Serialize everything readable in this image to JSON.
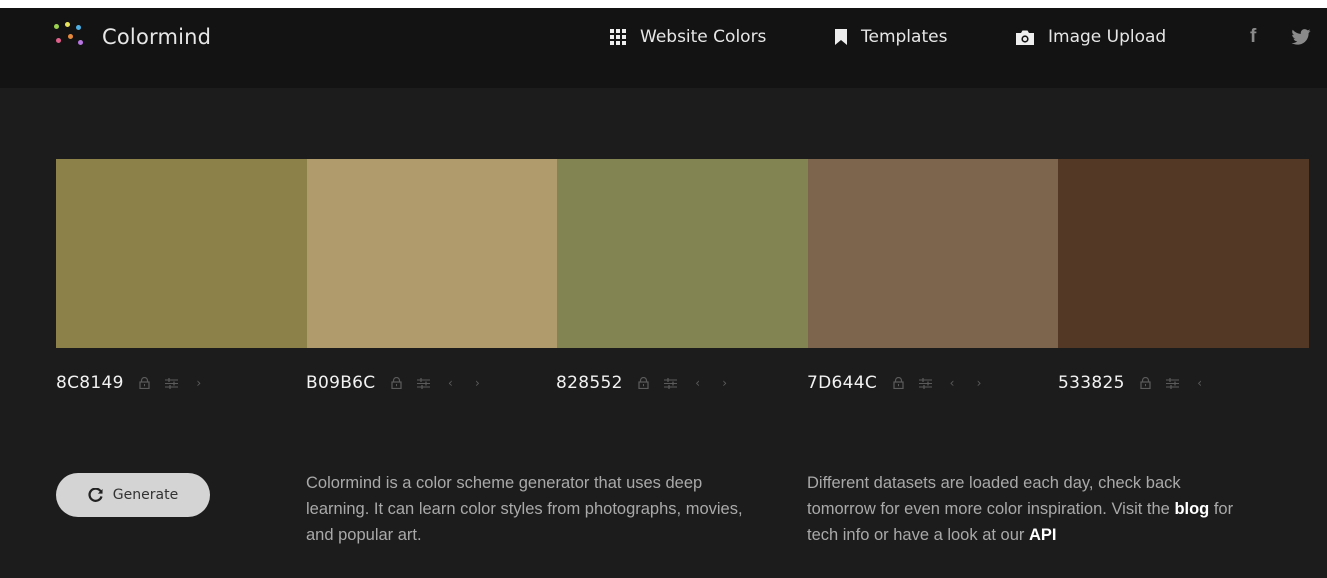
{
  "brand": {
    "name": "Colormind",
    "dot_colors": [
      "#9bd14f",
      "#e8e35a",
      "#4fb0e3",
      "#e0608c",
      "#e58a3c",
      "#b776e0"
    ]
  },
  "nav": {
    "website_colors": "Website Colors",
    "templates": "Templates",
    "image_upload": "Image Upload"
  },
  "social": {
    "facebook": "f"
  },
  "palette": [
    {
      "hex": "8C8149",
      "color": "#8C8149"
    },
    {
      "hex": "B09B6C",
      "color": "#B09B6C"
    },
    {
      "hex": "828552",
      "color": "#828552"
    },
    {
      "hex": "7D644C",
      "color": "#7D644C"
    },
    {
      "hex": "533825",
      "color": "#533825"
    }
  ],
  "controls": {
    "lock": "lock-icon",
    "adjust": "sliders-icon",
    "prev": "‹",
    "next": "›"
  },
  "generate_label": "Generate",
  "description": {
    "left": "Colormind is a color scheme generator that uses deep learning. It can learn color styles from photographs, movies, and popular art.",
    "right_part1": "Different datasets are loaded each day, check back tomorrow for even more color inspiration. Visit the ",
    "blog_link": "blog",
    "right_part2": " for tech info or have a look at our ",
    "api_link": "API"
  }
}
